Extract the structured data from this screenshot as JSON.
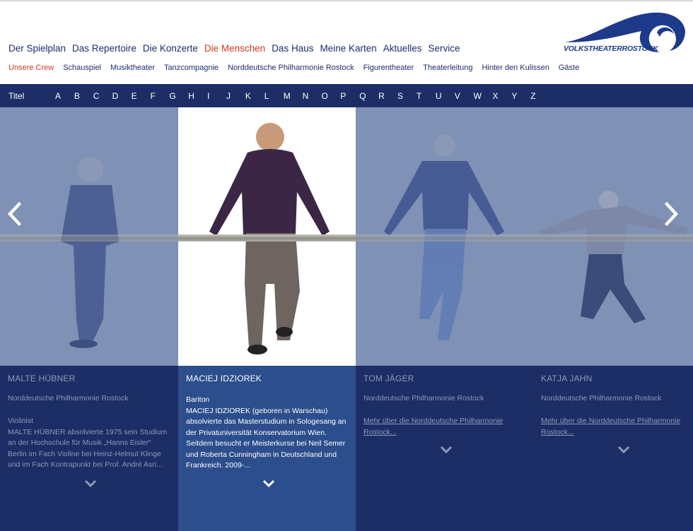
{
  "nav": {
    "main": [
      {
        "label": "Der Spielplan"
      },
      {
        "label": "Das Repertoire"
      },
      {
        "label": "Die Konzerte"
      },
      {
        "label": "Die Menschen"
      },
      {
        "label": "Das Haus"
      },
      {
        "label": "Meine Karten"
      },
      {
        "label": "Aktuelles"
      },
      {
        "label": "Service"
      }
    ],
    "sub": [
      {
        "label": "Unsere Crew"
      },
      {
        "label": "Schauspiel"
      },
      {
        "label": "Musiktheater"
      },
      {
        "label": "Tanzcompagnie"
      },
      {
        "label": "Norddeutsche Philharmonie Rostock"
      },
      {
        "label": "Figurentheater"
      },
      {
        "label": "Theaterleitung"
      },
      {
        "label": "Hinter den Kulissen"
      },
      {
        "label": "Gäste"
      }
    ]
  },
  "logo": {
    "text": "VOLKSTHEATERROSTOCK"
  },
  "alphabet": {
    "title": "Titel",
    "letters": [
      "A",
      "B",
      "C",
      "D",
      "E",
      "F",
      "G",
      "H",
      "I",
      "J",
      "K",
      "L",
      "M",
      "N",
      "O",
      "P",
      "Q",
      "R",
      "S",
      "T",
      "U",
      "V",
      "W",
      "X",
      "Y",
      "Z"
    ]
  },
  "people": [
    {
      "name": "MALTE HÜBNER",
      "org": "Norddeutsche Philharmonie Rostock",
      "body": "Violinist\nMALTE HÜBNER absolvierte 1975 sein Studium an der Hochschule für Musik „Hanns Eisler“ Berlin im Fach Violine bei Heinz-Helmut Klinge und im Fach Kontrapunkt bei Prof. André Asri..."
    },
    {
      "name": "MACIEJ IDZIOREK",
      "org": "",
      "body": "Bariton\nMACIEJ IDZIOREK (geboren in Warschau) absolvierte das Masterstudium in Sologesang an der Privatuniversität Konservatorium Wien. Seitdem besucht er Meisterkurse bei Neil Semer und Roberta Cunningham in Deutschland und Frankreich. 2009-..."
    },
    {
      "name": "TOM JÄGER",
      "org": "Norddeutsche Philharmonie Rostock",
      "link": "Mehr über die Norddeutsche Philharmonie Rostock..."
    },
    {
      "name": "KATJA JAHN",
      "org": "Norddeutsche Philharmonie Rostock",
      "link": "Mehr über die Norddeutsche Philharmonie Rostock..."
    }
  ],
  "icons": {
    "prev": "chevron-left-icon",
    "next": "chevron-right-icon",
    "expand": "chevron-down-icon"
  },
  "colors": {
    "navy": "#1d2e66",
    "active": "#d2381e",
    "selected_panel": "#2c4e8c",
    "dim_stage": "#7f91b4"
  }
}
